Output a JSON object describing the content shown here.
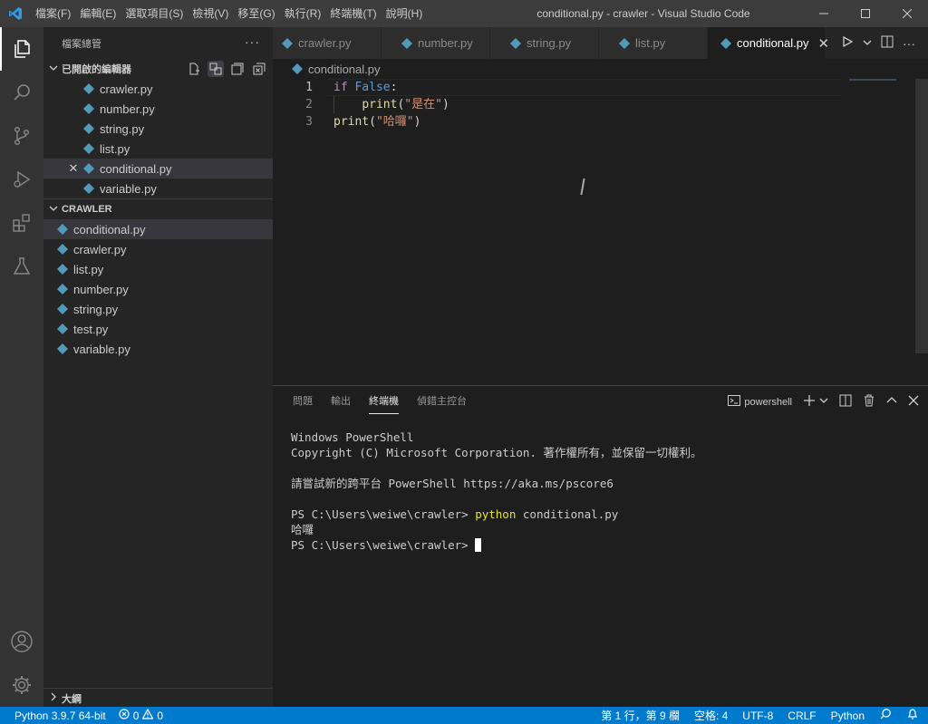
{
  "window": {
    "title": "conditional.py - crawler - Visual Studio Code"
  },
  "menu": [
    "檔案(F)",
    "編輯(E)",
    "選取項目(S)",
    "檢視(V)",
    "移至(G)",
    "執行(R)",
    "終端機(T)",
    "說明(H)"
  ],
  "sidebar": {
    "title": "檔案總管",
    "open_editors": {
      "label": "已開啟的編輯器",
      "files": [
        "crawler.py",
        "number.py",
        "string.py",
        "list.py",
        "conditional.py",
        "variable.py"
      ],
      "active": "conditional.py"
    },
    "folder": {
      "label": "CRAWLER",
      "files": [
        "conditional.py",
        "crawler.py",
        "list.py",
        "number.py",
        "string.py",
        "test.py",
        "variable.py"
      ]
    },
    "outline_label": "大綱"
  },
  "tabs": [
    "crawler.py",
    "number.py",
    "string.py",
    "list.py",
    "conditional.py"
  ],
  "active_tab": "conditional.py",
  "breadcrumb": "conditional.py",
  "code": {
    "line_numbers": [
      "1",
      "2",
      "3"
    ],
    "line1": {
      "kw": "if",
      "const": "False",
      "colon": ":"
    },
    "line2": {
      "fn": "print",
      "open": "(",
      "str": "\"是在\"",
      "close": ")"
    },
    "line3": {
      "fn": "print",
      "open": "(",
      "str": "\"哈囉\"",
      "close": ")"
    }
  },
  "panel": {
    "tabs": [
      "問題",
      "輸出",
      "終端機",
      "偵錯主控台"
    ],
    "active_tab": "終端機",
    "shell": "powershell",
    "terminal": {
      "line1": "Windows PowerShell",
      "line2": "Copyright (C) Microsoft Corporation. 著作權所有，並保留一切權利。",
      "line3": "請嘗試新的跨平台 PowerShell https://aka.ms/pscore6",
      "prompt": "PS C:\\Users\\weiwe\\crawler>",
      "command": "python",
      "command_args": "conditional.py",
      "output": "哈囉"
    }
  },
  "status": {
    "python": "Python 3.9.7 64-bit",
    "errors": "0",
    "warnings": "0",
    "position": "第 1 行，第 9 欄",
    "spaces": "空格: 4",
    "encoding": "UTF-8",
    "eol": "CRLF",
    "language": "Python"
  },
  "colors": {
    "accent": "#007acc",
    "python_icon": "#519aba",
    "keyword": "#c586c0",
    "constant": "#569cd6",
    "function": "#dcdcaa",
    "string": "#ce9178"
  }
}
